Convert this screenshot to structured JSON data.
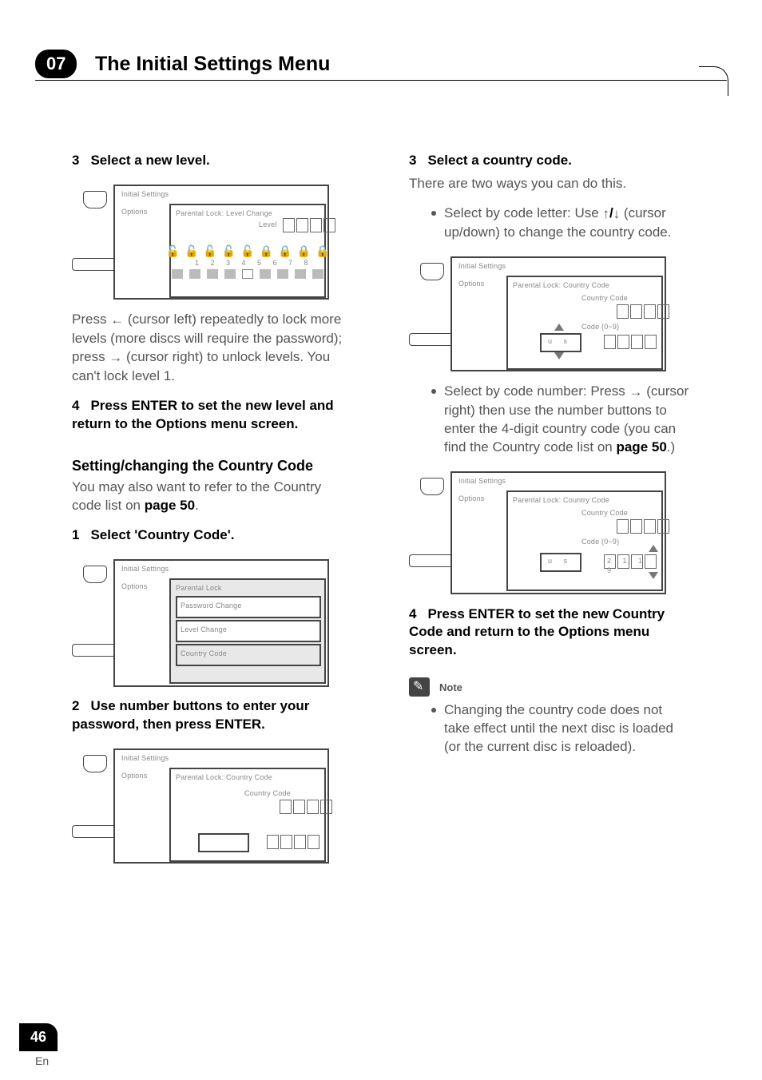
{
  "header": {
    "chapter_number": "07",
    "chapter_title": "The Initial Settings Menu"
  },
  "left": {
    "step3": "Select a new level.",
    "after_diag1_a": "Press ",
    "after_diag1_b": " (cursor left) repeatedly to lock more levels (more discs will require the password); press ",
    "after_diag1_c": " (cursor right) to unlock levels. You can't lock level 1.",
    "step4": "Press ENTER to set the new level and return to the Options menu screen.",
    "heading": "Setting/changing the Country Code",
    "heading_sub_a": "You may also want to refer to the Country code list on ",
    "heading_sub_page": "page 50",
    "heading_sub_b": ".",
    "step1": "Select 'Country Code'.",
    "step2": "Use number buttons to enter your password, then press ENTER."
  },
  "right": {
    "step3": "Select a country code.",
    "step3_sub": "There are two ways you can do this.",
    "bullet1_a": "Select by code letter: Use ",
    "bullet1_b": " (cursor up/down) to change the country code.",
    "bullet2_a": "Select by code number: Press ",
    "bullet2_b": " (cursor right) then use the number buttons to enter the 4-digit country code (you can find the Country code list on ",
    "bullet2_page": "page 50",
    "bullet2_c": ".)",
    "step4": "Press ENTER to set the new Country Code and return to the Options menu screen.",
    "note_label": "Note",
    "note_body": "Changing the country code does not take effect until the next disc is loaded (or the current disc is reloaded)."
  },
  "diagrams": {
    "d1": {
      "t1": "Initial Settings",
      "t2": "Options",
      "t3_a": "Parental Lock: Level Change",
      "t3_b": "Level",
      "t3_c": "1  2  3  4  5  6  7  8"
    },
    "d2": {
      "t1": "Initial Settings",
      "t2": "Options",
      "m1": "Password Change",
      "m2": "Level Change",
      "m3": "Country Code"
    },
    "d3": {
      "t1": "Initial Settings",
      "t2": "Options",
      "t3": "Parental Lock: Country Code",
      "t4": "Country Code"
    },
    "d4": {
      "t1": "Initial Settings",
      "t2": "Options",
      "t3": "Parental Lock: Country Code",
      "t4": "Country Code",
      "t5": "Code (0~9)",
      "code": "u  s"
    },
    "d5": {
      "t1": "Initial Settings",
      "t2": "Options",
      "t3": "Parental Lock: Country Code",
      "t4": "Country Code",
      "t5": "Code (0~9)",
      "num": "2  1  1  9",
      "code": "u  s"
    }
  },
  "footer": {
    "page": "46",
    "lang": "En"
  },
  "glyph": {
    "left": "←",
    "right": "→",
    "up": "↑",
    "down": "↓",
    "updown": "↑/↓"
  }
}
